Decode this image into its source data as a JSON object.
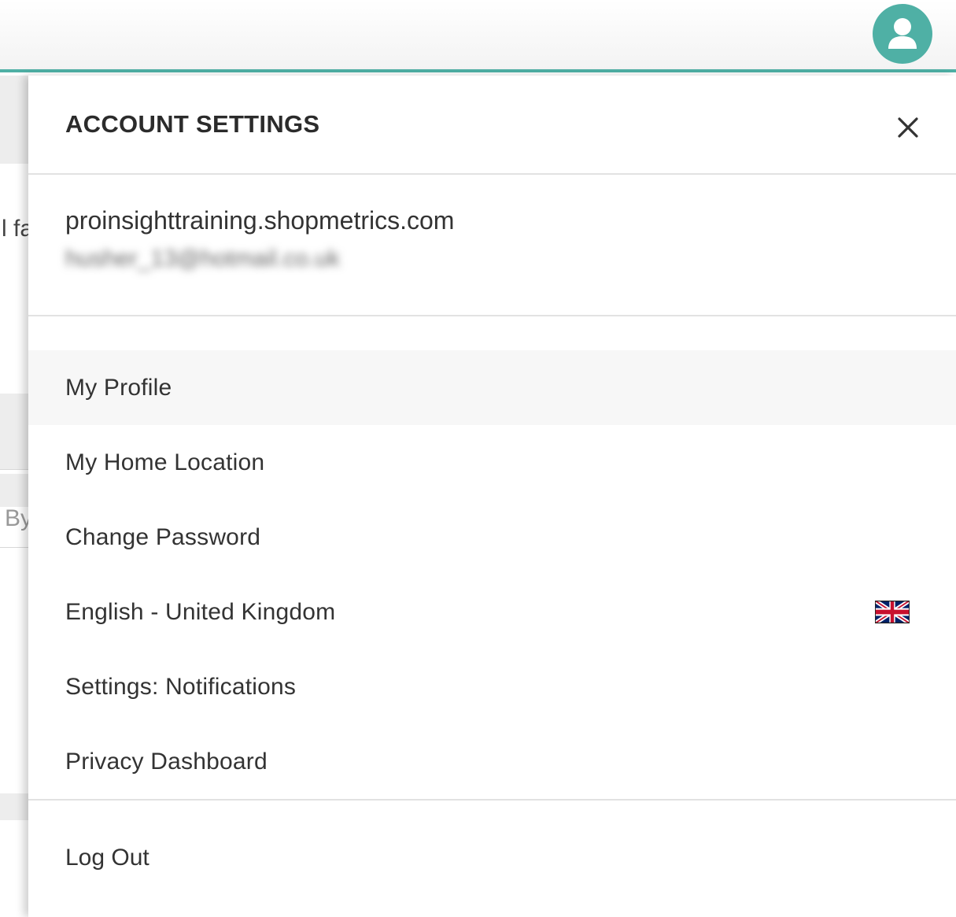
{
  "header": {
    "accent_color": "#4fb0a5",
    "avatar_icon": "user-avatar-icon"
  },
  "background": {
    "fragment_1": "l fa",
    "fragment_2": "By"
  },
  "panel": {
    "title": "ACCOUNT SETTINGS",
    "close_icon": "close-icon",
    "domain": "proinsighttraining.shopmetrics.com",
    "email": "husher_13@hotmail.co.uk",
    "menu": [
      {
        "label": "My Profile"
      },
      {
        "label": "My Home Location"
      },
      {
        "label": "Change Password"
      },
      {
        "label": "English - United Kingdom",
        "icon": "uk-flag-icon"
      },
      {
        "label": "Settings: Notifications"
      },
      {
        "label": "Privacy Dashboard"
      }
    ],
    "logout_label": "Log Out"
  }
}
